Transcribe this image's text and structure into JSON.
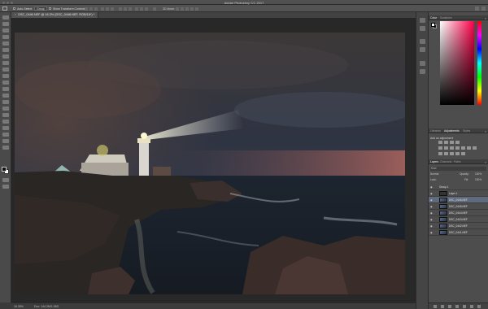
{
  "app": {
    "title": "Adobe Photoshop CC 2017"
  },
  "options_bar": {
    "auto_select_label": "Auto-Select:",
    "auto_select_value": "Group",
    "show_transform_label": "Show Transform Controls",
    "mode_3d_label": "3D Mode:"
  },
  "document": {
    "tab_label": "DSC_0446.NEF @ 16.3% (DSC_0446.NEF, RGB/16*) *"
  },
  "status": {
    "zoom": "16.35%",
    "doc_size": "Doc: 144.2M/1.08G"
  },
  "color_panel": {
    "tabs": [
      "Color",
      "Swatches"
    ],
    "fg_color": "#ffffff",
    "bg_color": "#111111"
  },
  "adjustments_panel": {
    "tabs": [
      "Libraries",
      "Adjustments",
      "Styles"
    ],
    "add_label": "Add an adjustment"
  },
  "layers_panel": {
    "tabs": [
      "Layers",
      "Channels",
      "Paths"
    ],
    "filter_label": "Kind",
    "blend_mode": "Normal",
    "opacity_label": "Opacity:",
    "opacity_value": "100%",
    "lock_label": "Lock:",
    "fill_label": "Fill:",
    "fill_value": "100%",
    "layers": [
      {
        "name": "Group 1"
      },
      {
        "name": "Layer 1"
      },
      {
        "name": "DSC_0446.NEF"
      },
      {
        "name": "DSC_0445.NEF"
      },
      {
        "name": "DSC_0444.NEF"
      },
      {
        "name": "DSC_0443.NEF"
      },
      {
        "name": "DSC_0442.NEF"
      },
      {
        "name": "DSC_0441.NEF"
      }
    ]
  }
}
